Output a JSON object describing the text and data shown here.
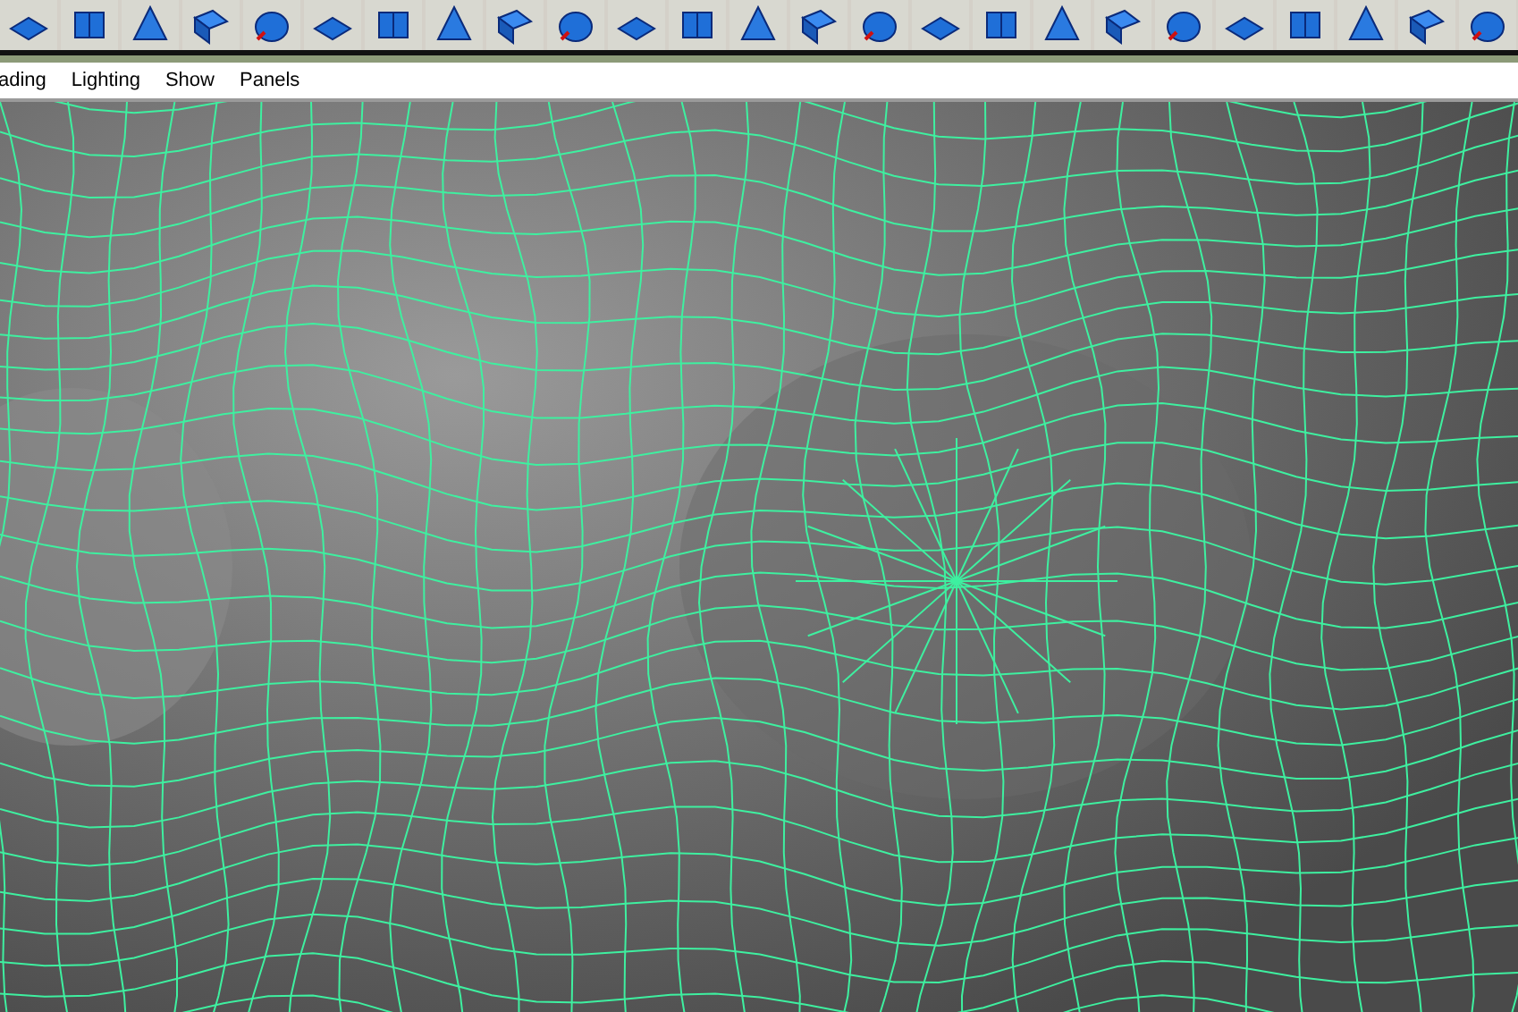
{
  "menu_bar": {
    "items": [
      {
        "label": "ading"
      },
      {
        "label": "Lighting"
      },
      {
        "label": "Show"
      },
      {
        "label": "Panels"
      }
    ]
  }
}
